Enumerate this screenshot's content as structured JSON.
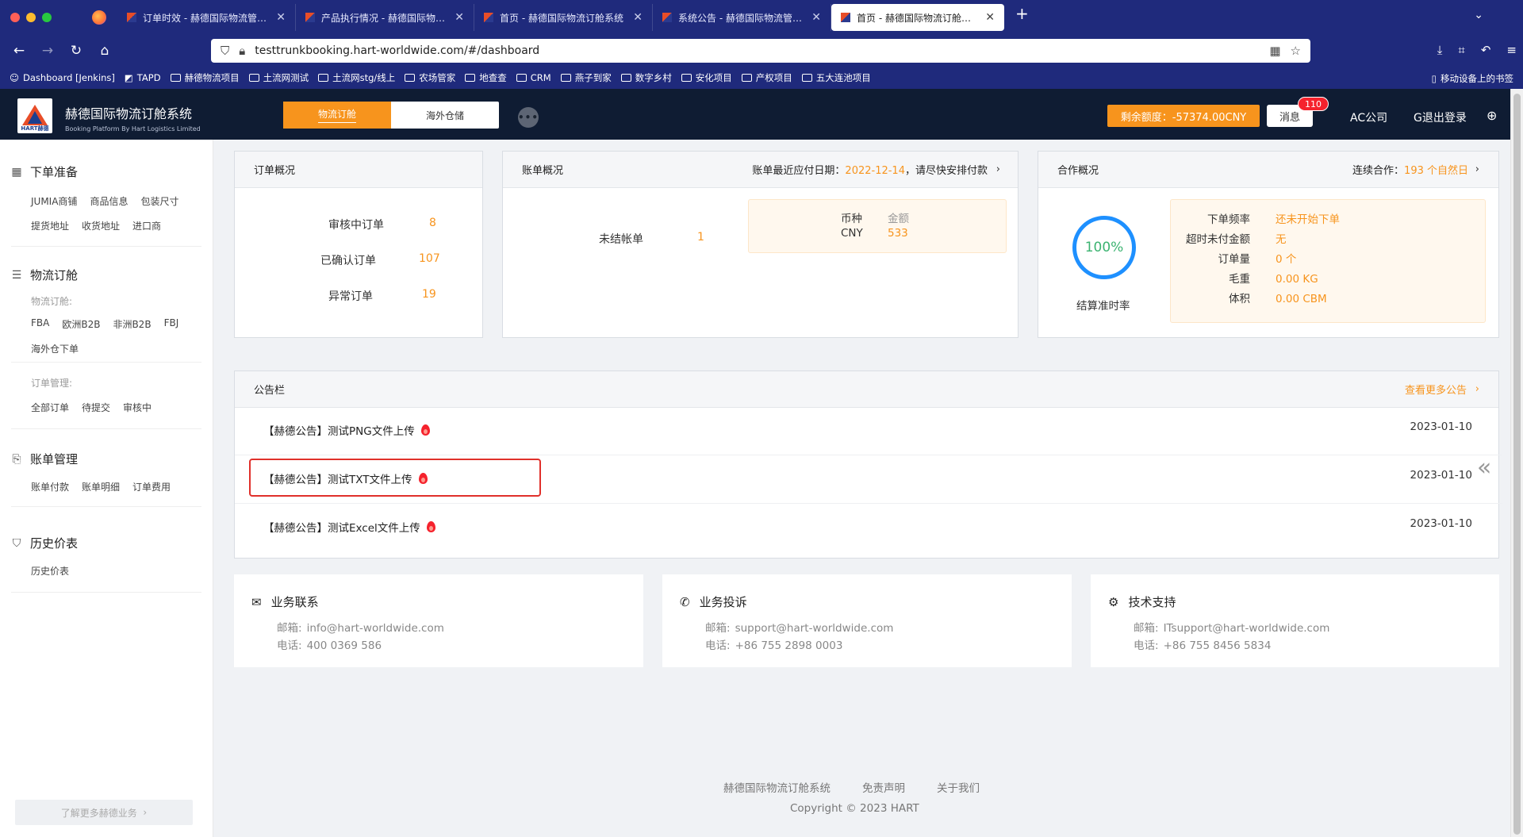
{
  "browser": {
    "tabs": [
      {
        "title": "订单时效 - 赫德国际物流管理系统"
      },
      {
        "title": "产品执行情况 - 赫德国际物流管理系统"
      },
      {
        "title": "首页 - 赫德国际物流订舱系统"
      },
      {
        "title": "系统公告 - 赫德国际物流管理系统"
      },
      {
        "title": "首页 - 赫德国际物流订舱系统"
      }
    ],
    "url": "testtrunkbooking.hart-worldwide.com/#/dashboard",
    "bookmarks": [
      "Dashboard [Jenkins]",
      "TAPD",
      "赫德物流项目",
      "土流网测试",
      "土流网stg/线上",
      "农场管家",
      "地查查",
      "CRM",
      "燕子到家",
      "数字乡村",
      "安化项目",
      "产权项目",
      "五大连池项目"
    ],
    "mobile_bookmarks": "移动设备上的书签"
  },
  "header": {
    "brand_cn": "赫德国际物流订舱系统",
    "brand_en": "Booking Platform By Hart Logistics Limited",
    "logo_text": "HART赫德",
    "mode_options": [
      "物流订舱",
      "海外仓储"
    ],
    "balance": "剩余额度：-57374.00CNY",
    "messages": "消息",
    "message_count": "110",
    "company": "AC公司",
    "logout": "退出登录"
  },
  "sidebar": {
    "sections": [
      {
        "title": "下单准备",
        "links": [
          "JUMIA商铺",
          "商品信息",
          "包装尺寸",
          "提货地址",
          "收货地址",
          "进口商"
        ]
      },
      {
        "title": "物流订舱",
        "sub1": "物流订舱:",
        "links1": [
          "FBA",
          "欧洲B2B",
          "非洲B2B",
          "FBJ",
          "海外仓下单"
        ],
        "sub2": "订单管理:",
        "links2": [
          "全部订单",
          "待提交",
          "审核中"
        ]
      },
      {
        "title": "账单管理",
        "links": [
          "账单付款",
          "账单明细",
          "订单费用"
        ]
      },
      {
        "title": "历史价表",
        "links": [
          "历史价表"
        ]
      }
    ],
    "learn_more": "了解更多赫德业务"
  },
  "orders": {
    "title": "订单概况",
    "rows": [
      {
        "label": "审核中订单",
        "value": "8"
      },
      {
        "label": "已确认订单",
        "value": "107"
      },
      {
        "label": "异常订单",
        "value": "19"
      }
    ]
  },
  "bills": {
    "title": "账单概况",
    "due_prefix": "账单最近应付日期：",
    "due_date": "2022-12-14",
    "due_suffix": "，请尽快安排付款",
    "unsettled_label": "未结帐单",
    "unsettled_value": "1",
    "currency_head": "币种",
    "amount_head": "金额",
    "currency": "CNY",
    "amount": "533"
  },
  "cooperation": {
    "title": "合作概况",
    "continuous_prefix": "连续合作：",
    "continuous_value": "193 个自然日",
    "rate": "100%",
    "rate_label": "结算准时率",
    "rows": [
      {
        "label": "下单频率",
        "value": "还未开始下单"
      },
      {
        "label": "超时未付金额",
        "value": "无"
      },
      {
        "label": "订单量",
        "value": "0 个"
      },
      {
        "label": "毛重",
        "value": "0.00 KG"
      },
      {
        "label": "体积",
        "value": "0.00 CBM"
      }
    ]
  },
  "notices": {
    "title": "公告栏",
    "more": "查看更多公告",
    "items": [
      {
        "title": "【赫德公告】测试PNG文件上传",
        "date": "2023-01-10"
      },
      {
        "title": "【赫德公告】测试TXT文件上传",
        "date": "2023-01-10"
      },
      {
        "title": "【赫德公告】测试Excel文件上传",
        "date": "2023-01-10"
      }
    ]
  },
  "contacts": [
    {
      "title": "业务联系",
      "email_label": "邮箱:",
      "email": "info@hart-worldwide.com",
      "phone_label": "电话:",
      "phone": "400 0369 586"
    },
    {
      "title": "业务投诉",
      "email_label": "邮箱:",
      "email": "support@hart-worldwide.com",
      "phone_label": "电话:",
      "phone": "+86 755 2898 0003"
    },
    {
      "title": "技术支持",
      "email_label": "邮箱:",
      "email": "ITsupport@hart-worldwide.com",
      "phone_label": "电话:",
      "phone": "+86 755 8456 5834"
    }
  ],
  "footer": {
    "links": [
      "赫德国际物流订舱系统",
      "免责声明",
      "关于我们"
    ],
    "copyright": "Copyright © 2023 HART"
  }
}
